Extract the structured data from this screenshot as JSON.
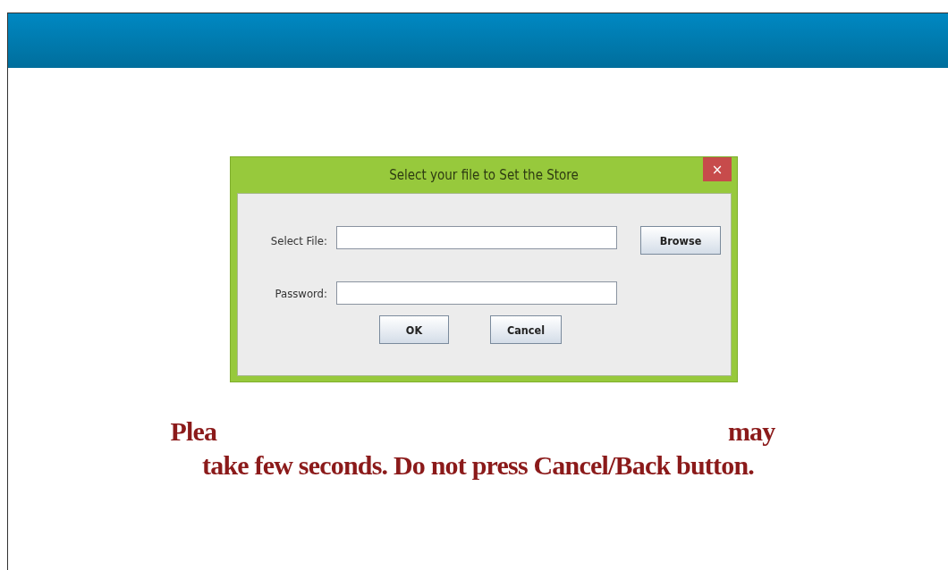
{
  "dialog": {
    "title": "Select your file to Set the Store",
    "close": "×",
    "fields": [
      {
        "label": "Select File:",
        "button": "Browse"
      },
      {
        "label": "Password:"
      }
    ],
    "buttons": [
      "OK",
      "Cancel"
    ]
  },
  "message": {
    "line_1_visible_start": "Plea",
    "line_1_visible_end": "may",
    "line_2": "take few seconds. Do not press Cancel/Back button."
  }
}
